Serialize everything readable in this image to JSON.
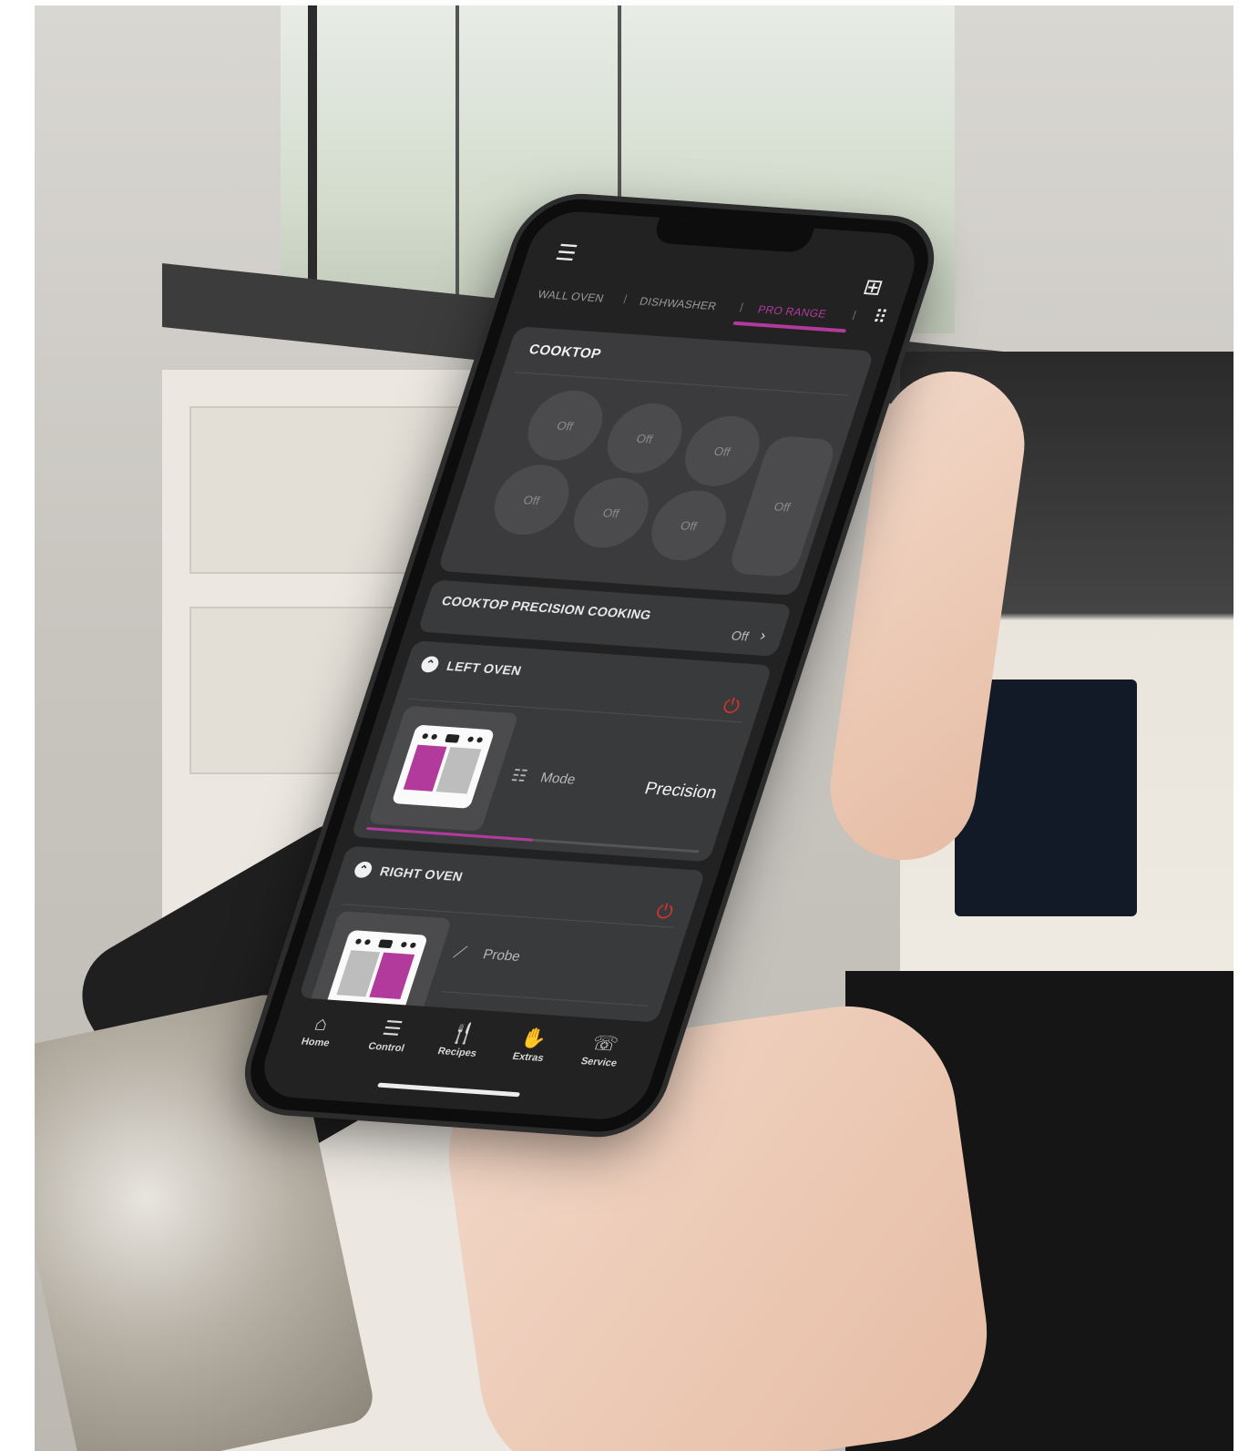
{
  "topbar": {
    "menu_icon": "menu-icon",
    "add_appliance_icon": "add-appliance-icon"
  },
  "tabs": [
    {
      "label": "WALL OVEN",
      "active": false
    },
    {
      "label": "DISHWASHER",
      "active": false
    },
    {
      "label": "PRO RANGE",
      "active": true
    }
  ],
  "grid_icon": "grid-icon",
  "cooktop": {
    "title": "COOKTOP",
    "burners": [
      "Off",
      "Off",
      "Off",
      "Off",
      "Off",
      "Off"
    ],
    "griddle": "Off"
  },
  "precision_cooking": {
    "title": "COOKTOP PRECISION COOKING",
    "value": "Off"
  },
  "left_oven": {
    "title": "LEFT OVEN",
    "mode_label": "Mode",
    "mode_value": "Precision",
    "progress": 0.5
  },
  "right_oven": {
    "title": "RIGHT OVEN",
    "probe_label": "Probe"
  },
  "nav": [
    {
      "label": "Home",
      "icon": "home-icon"
    },
    {
      "label": "Control",
      "icon": "control-icon"
    },
    {
      "label": "Recipes",
      "icon": "recipes-icon"
    },
    {
      "label": "Extras",
      "icon": "extras-icon"
    },
    {
      "label": "Service",
      "icon": "service-icon"
    }
  ],
  "colors": {
    "accent": "#b23a9c",
    "power": "#d4332e",
    "screen_bg": "#222223"
  }
}
